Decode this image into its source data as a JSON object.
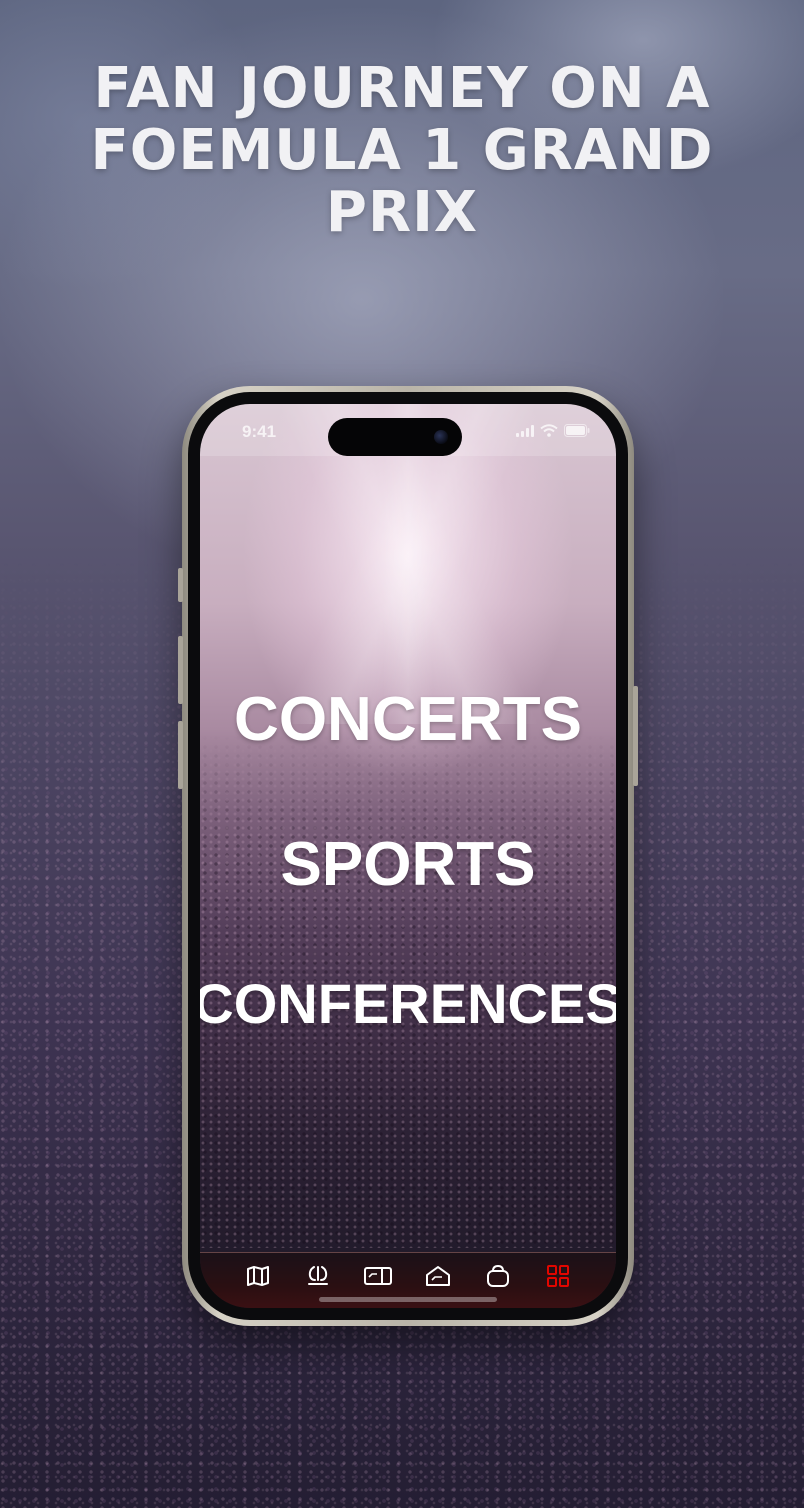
{
  "page": {
    "title": "FAN JOURNEY ON A FOEMULA 1 GRAND PRIX"
  },
  "phone": {
    "status_bar": {
      "time": "9:41"
    },
    "menu": {
      "items": [
        {
          "label": "CONCERTS"
        },
        {
          "label": "SPORTS"
        },
        {
          "label": "CONFERENCES"
        }
      ]
    },
    "tab_bar": {
      "tabs": [
        {
          "icon": "map-icon",
          "active": false
        },
        {
          "icon": "car-icon",
          "active": false
        },
        {
          "icon": "ticket-icon",
          "active": false
        },
        {
          "icon": "garage-icon",
          "active": false
        },
        {
          "icon": "shopping-bag-icon",
          "active": false
        },
        {
          "icon": "grid-icon",
          "active": true
        }
      ],
      "active_color": "#e10600",
      "inactive_color": "#ffffff"
    }
  }
}
